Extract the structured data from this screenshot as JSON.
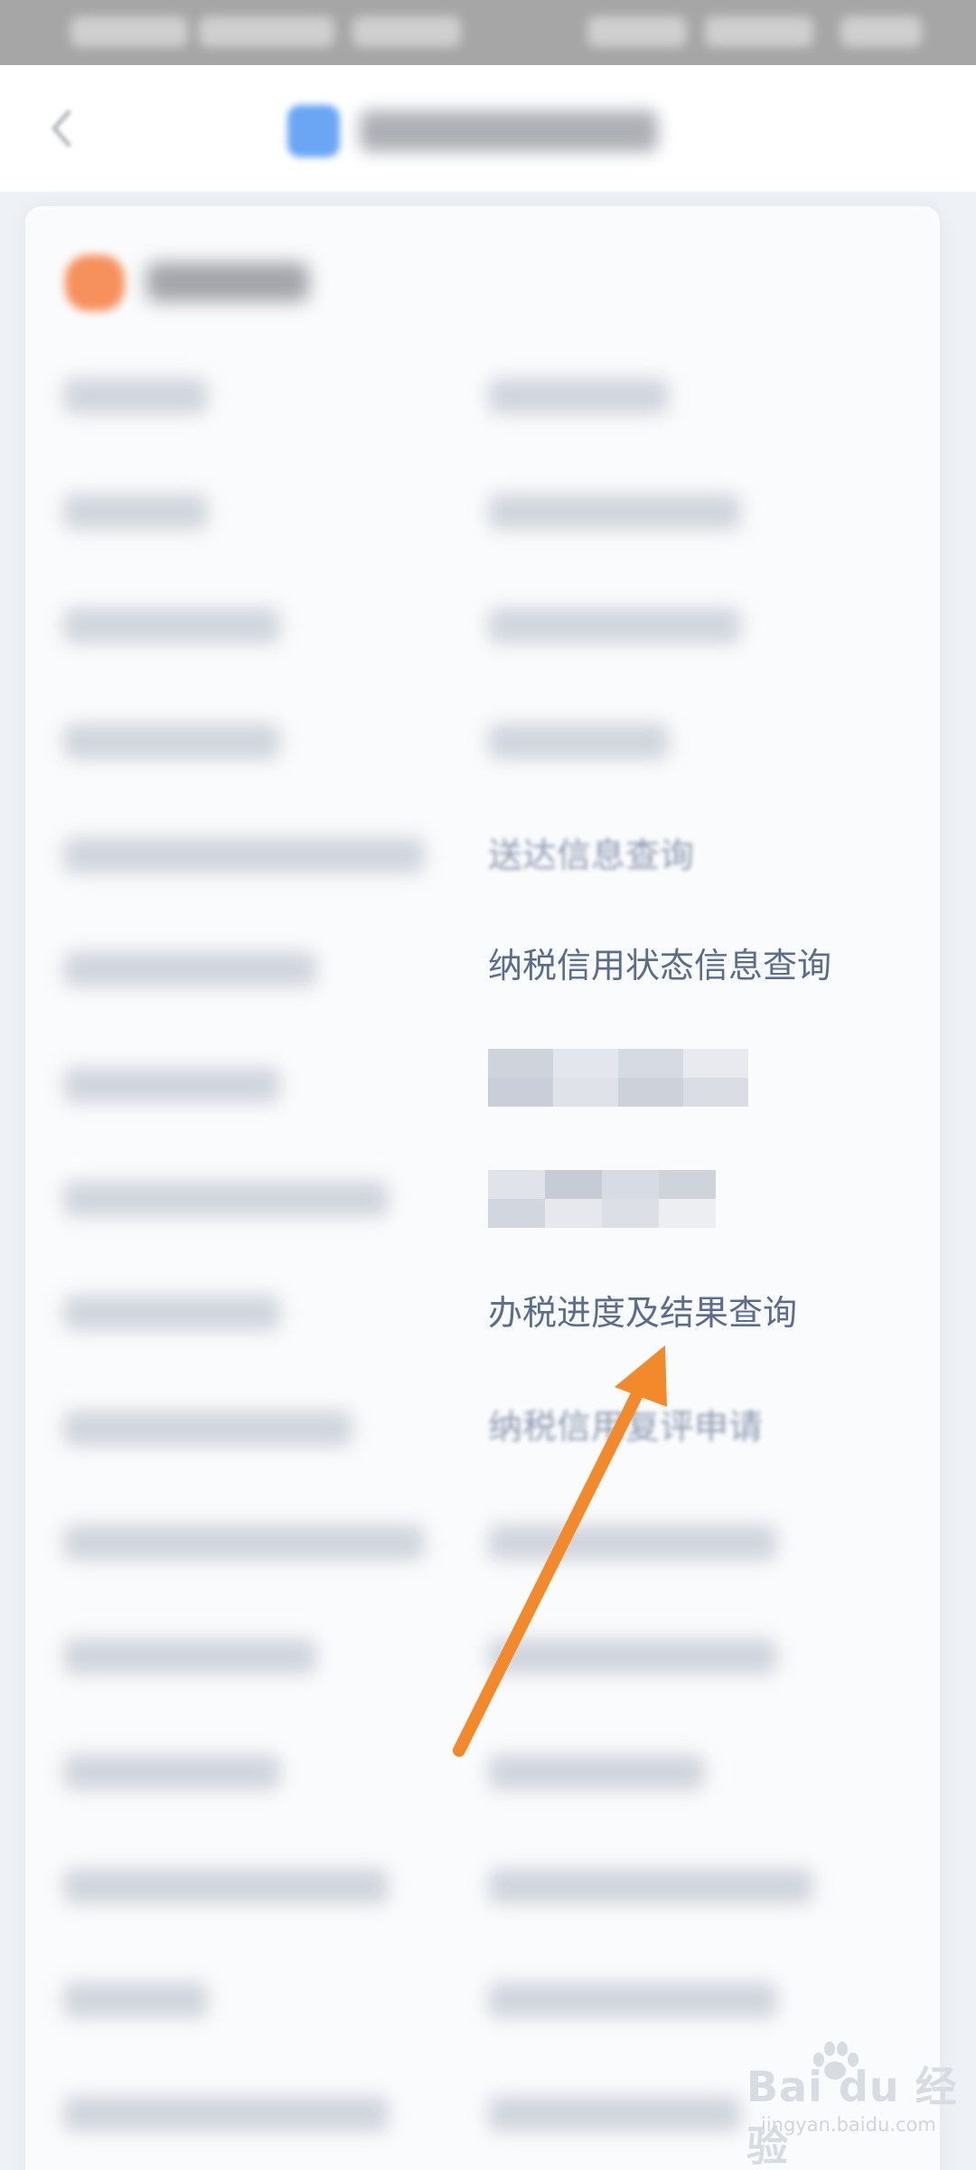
{
  "services": {
    "visible_items": [
      {
        "id": "credit-status-query",
        "text": "纳税信用状态信息查询"
      },
      {
        "id": "tax-progress-query",
        "text": "办税进度及结果查询"
      },
      {
        "id": "credit-review-apply",
        "text": "纳税信用复评申请"
      },
      {
        "id": "partial-info-query",
        "text": "送达信息查询"
      }
    ]
  },
  "watermark": {
    "logo": "Bai du 经验",
    "subtitle": "jingyan.baidu.com"
  },
  "colors": {
    "status_bar": "#a6a6a6",
    "nav_bar": "#ffffff",
    "panel": "#fafbfc",
    "link_text": "#5a6d8c",
    "arrow": "#f28a2c",
    "section_icon": "#f6905c",
    "app_icon": "#6aa6f4"
  },
  "icons": {
    "back": "chevron-left-icon",
    "app": "app-icon",
    "section": "service-section-icon",
    "annotation": "orange-arrow-icon"
  }
}
